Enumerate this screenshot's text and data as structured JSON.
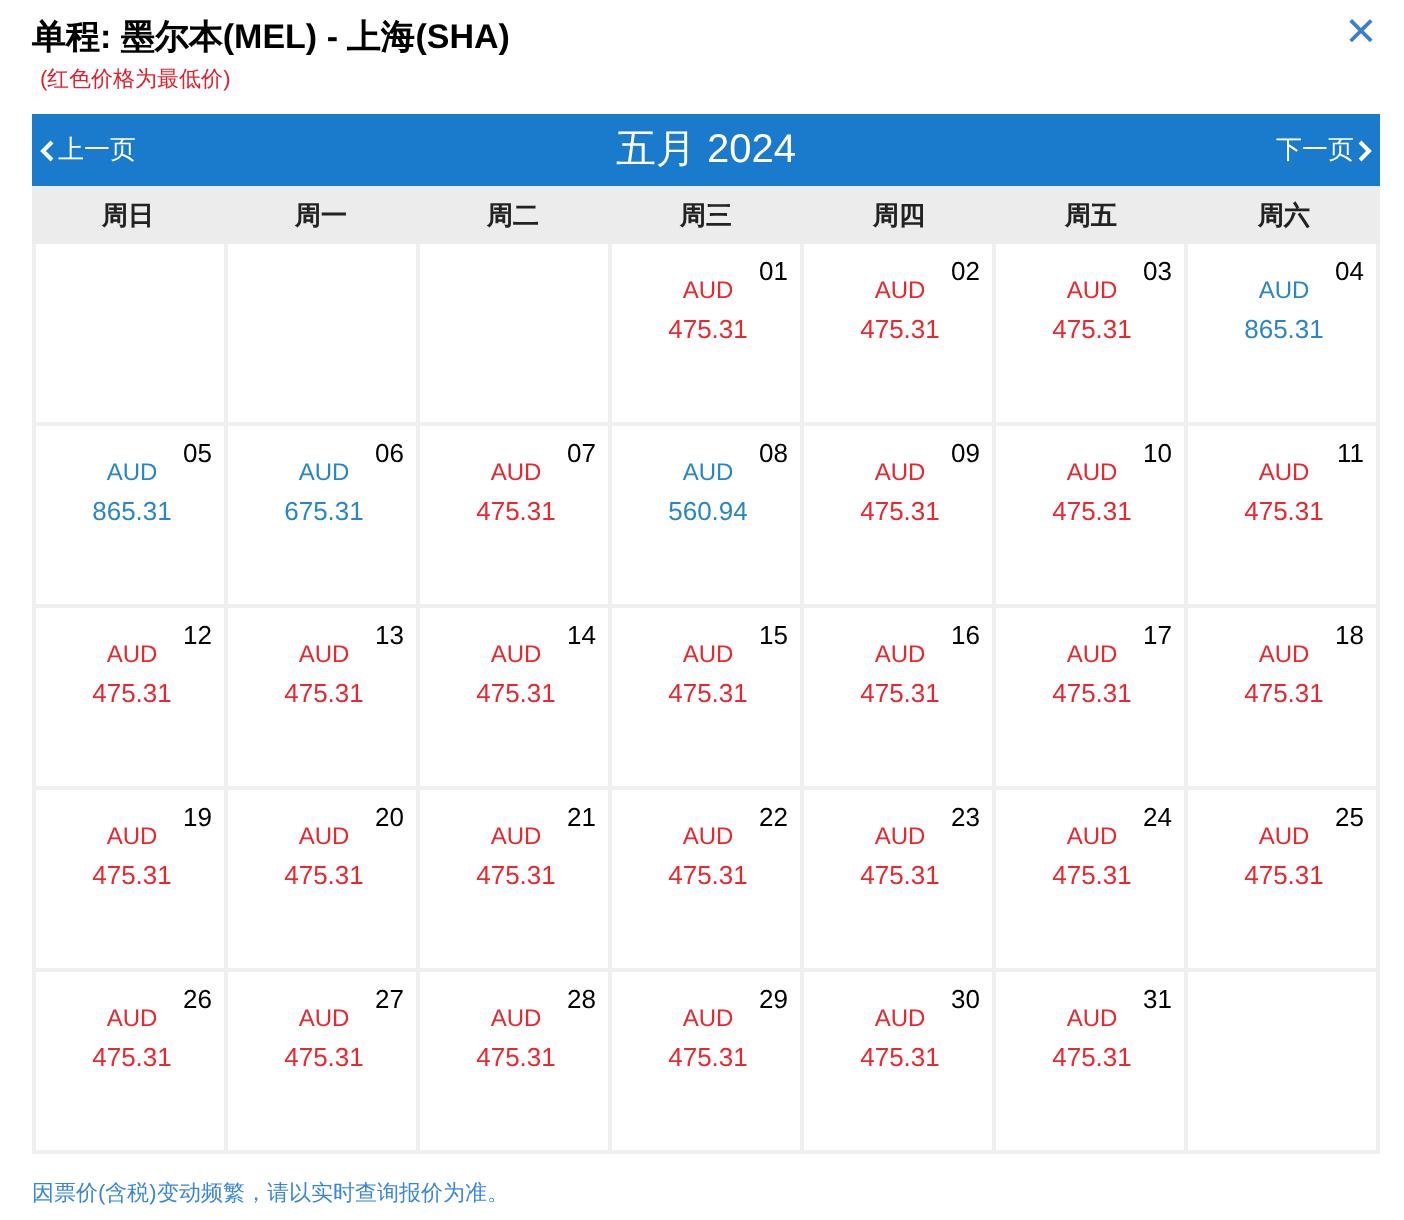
{
  "title": "单程: 墨尔本(MEL) - 上海(SHA)",
  "note": "(红色价格为最低价)",
  "close": "×",
  "calendar": {
    "prev": "上一页",
    "month": "五月 2024",
    "next": "下一页",
    "weekdays": [
      "周日",
      "周一",
      "周二",
      "周三",
      "周四",
      "周五",
      "周六"
    ],
    "weeks": [
      [
        {
          "kind": "empty"
        },
        {
          "kind": "empty"
        },
        {
          "kind": "empty"
        },
        {
          "kind": "day",
          "day": "01",
          "currency": "AUD",
          "price": "475.31",
          "lowest": true
        },
        {
          "kind": "day",
          "day": "02",
          "currency": "AUD",
          "price": "475.31",
          "lowest": true
        },
        {
          "kind": "day",
          "day": "03",
          "currency": "AUD",
          "price": "475.31",
          "lowest": true
        },
        {
          "kind": "day",
          "day": "04",
          "currency": "AUD",
          "price": "865.31",
          "lowest": false
        }
      ],
      [
        {
          "kind": "day",
          "day": "05",
          "currency": "AUD",
          "price": "865.31",
          "lowest": false
        },
        {
          "kind": "day",
          "day": "06",
          "currency": "AUD",
          "price": "675.31",
          "lowest": false
        },
        {
          "kind": "day",
          "day": "07",
          "currency": "AUD",
          "price": "475.31",
          "lowest": true
        },
        {
          "kind": "day",
          "day": "08",
          "currency": "AUD",
          "price": "560.94",
          "lowest": false
        },
        {
          "kind": "day",
          "day": "09",
          "currency": "AUD",
          "price": "475.31",
          "lowest": true
        },
        {
          "kind": "day",
          "day": "10",
          "currency": "AUD",
          "price": "475.31",
          "lowest": true
        },
        {
          "kind": "day",
          "day": "11",
          "currency": "AUD",
          "price": "475.31",
          "lowest": true
        }
      ],
      [
        {
          "kind": "day",
          "day": "12",
          "currency": "AUD",
          "price": "475.31",
          "lowest": true
        },
        {
          "kind": "day",
          "day": "13",
          "currency": "AUD",
          "price": "475.31",
          "lowest": true
        },
        {
          "kind": "day",
          "day": "14",
          "currency": "AUD",
          "price": "475.31",
          "lowest": true
        },
        {
          "kind": "day",
          "day": "15",
          "currency": "AUD",
          "price": "475.31",
          "lowest": true
        },
        {
          "kind": "day",
          "day": "16",
          "currency": "AUD",
          "price": "475.31",
          "lowest": true
        },
        {
          "kind": "day",
          "day": "17",
          "currency": "AUD",
          "price": "475.31",
          "lowest": true
        },
        {
          "kind": "day",
          "day": "18",
          "currency": "AUD",
          "price": "475.31",
          "lowest": true
        }
      ],
      [
        {
          "kind": "day",
          "day": "19",
          "currency": "AUD",
          "price": "475.31",
          "lowest": true
        },
        {
          "kind": "day",
          "day": "20",
          "currency": "AUD",
          "price": "475.31",
          "lowest": true
        },
        {
          "kind": "day",
          "day": "21",
          "currency": "AUD",
          "price": "475.31",
          "lowest": true
        },
        {
          "kind": "day",
          "day": "22",
          "currency": "AUD",
          "price": "475.31",
          "lowest": true
        },
        {
          "kind": "day",
          "day": "23",
          "currency": "AUD",
          "price": "475.31",
          "lowest": true
        },
        {
          "kind": "day",
          "day": "24",
          "currency": "AUD",
          "price": "475.31",
          "lowest": true
        },
        {
          "kind": "day",
          "day": "25",
          "currency": "AUD",
          "price": "475.31",
          "lowest": true
        }
      ],
      [
        {
          "kind": "day",
          "day": "26",
          "currency": "AUD",
          "price": "475.31",
          "lowest": true
        },
        {
          "kind": "day",
          "day": "27",
          "currency": "AUD",
          "price": "475.31",
          "lowest": true
        },
        {
          "kind": "day",
          "day": "28",
          "currency": "AUD",
          "price": "475.31",
          "lowest": true
        },
        {
          "kind": "day",
          "day": "29",
          "currency": "AUD",
          "price": "475.31",
          "lowest": true
        },
        {
          "kind": "day",
          "day": "30",
          "currency": "AUD",
          "price": "475.31",
          "lowest": true
        },
        {
          "kind": "day",
          "day": "31",
          "currency": "AUD",
          "price": "475.31",
          "lowest": true
        },
        {
          "kind": "empty"
        }
      ]
    ]
  },
  "footer": "因票价(含税)变动频繁，请以实时查询报价为准。"
}
